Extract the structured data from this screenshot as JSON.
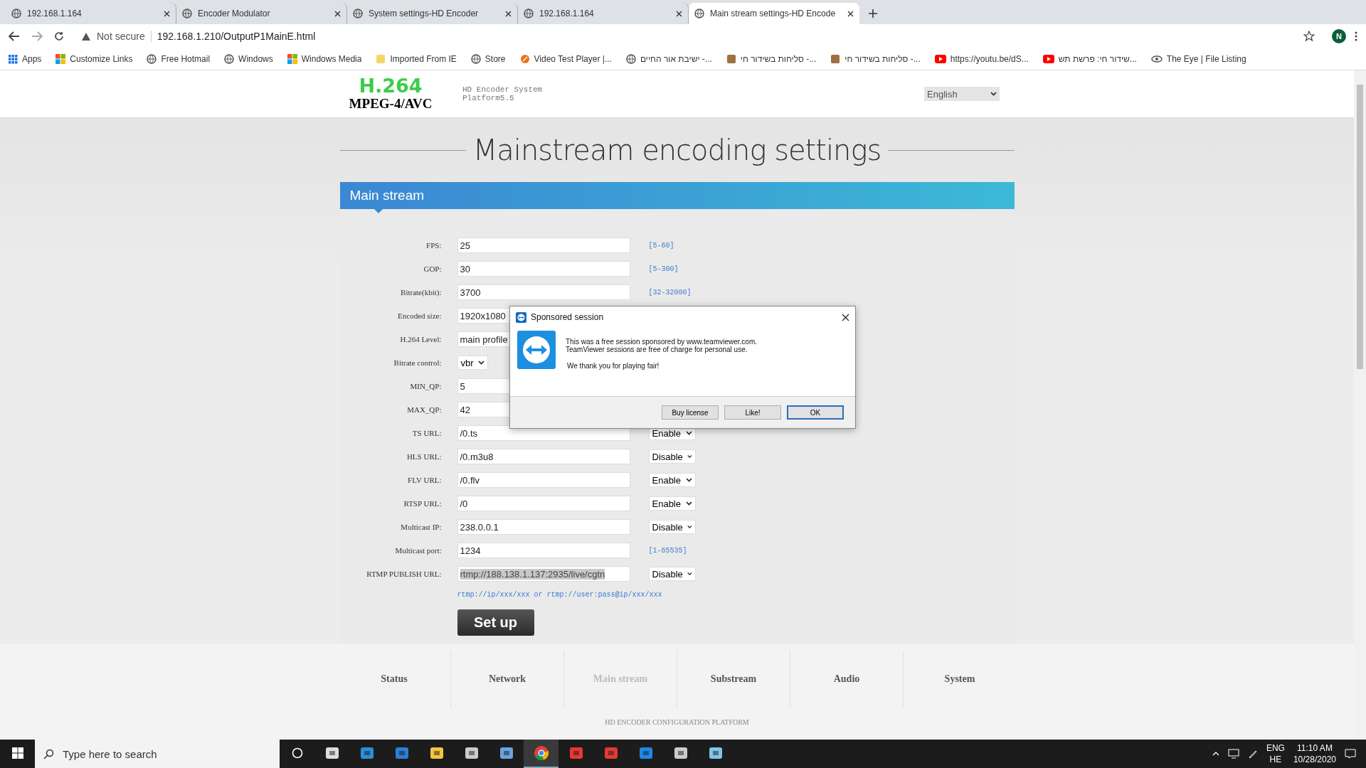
{
  "browser": {
    "tabs": [
      {
        "title": "192.168.1.164",
        "selected": false
      },
      {
        "title": "Encoder Modulator",
        "selected": false
      },
      {
        "title": "System settings-HD Encoder",
        "selected": false
      },
      {
        "title": "192.168.1.164",
        "selected": false
      },
      {
        "title": "Main stream settings-HD Encode",
        "selected": true
      }
    ],
    "security": "Not secure",
    "url": "192.168.1.210/OutputP1MainE.html",
    "profile": "N",
    "bookmarks": [
      "Apps",
      "Customize Links",
      "Free Hotmail",
      "Windows",
      "Windows Media",
      "Imported From IE",
      "Store",
      "Video Test Player |...",
      "ישיבת אור החיים -...",
      "סליחות בשידור חי -...",
      "סליחות בשידור חי -...",
      "https://youtu.be/dS...",
      "שידור חי: פרשת תש...",
      "The Eye | File Listing"
    ]
  },
  "header": {
    "logo_top": "H.264",
    "logo_bottom": "MPEG-4/AVC",
    "subtitle_1": "HD Encoder System",
    "subtitle_2": "Platform5.5",
    "language": "English"
  },
  "page_title": "Mainstream encoding settings",
  "panel_title": "Main stream",
  "form": [
    {
      "label": "FPS:",
      "kind": "input",
      "value": "25",
      "hint": "[5-60]"
    },
    {
      "label": "GOP:",
      "kind": "input",
      "value": "30",
      "hint": "[5-300]"
    },
    {
      "label": "Bitrate(kbit):",
      "kind": "input",
      "value": "3700",
      "hint": "[32-32000]"
    },
    {
      "label": "Encoded size:",
      "kind": "input",
      "value": "1920x1080"
    },
    {
      "label": "H.264 Level:",
      "kind": "input",
      "value": "main profile"
    },
    {
      "label": "Bitrate control:",
      "kind": "select",
      "value": "vbr"
    },
    {
      "label": "MIN_QP:",
      "kind": "input",
      "value": "5"
    },
    {
      "label": "MAX_QP:",
      "kind": "input",
      "value": "42"
    },
    {
      "label": "TS URL:",
      "kind": "input",
      "value": "/0.ts",
      "toggle": "Enable"
    },
    {
      "label": "HLS URL:",
      "kind": "input",
      "value": "/0.m3u8",
      "toggle": "Disable"
    },
    {
      "label": "FLV URL:",
      "kind": "input",
      "value": "/0.flv",
      "toggle": "Enable"
    },
    {
      "label": "RTSP URL:",
      "kind": "input",
      "value": "/0",
      "toggle": "Enable"
    },
    {
      "label": "Multicast IP:",
      "kind": "input",
      "value": "238.0.0.1",
      "toggle": "Disable"
    },
    {
      "label": "Multicast port:",
      "kind": "input",
      "value": "1234",
      "hint": "[1-65535]"
    },
    {
      "label": "RTMP PUBLISH URL:",
      "kind": "input",
      "value": "rtmp://188.138.1.137:2935/live/cgtn",
      "highlighted": true,
      "toggle": "Disable"
    }
  ],
  "form_note": "rtmp://ip/xxx/xxx or rtmp://user:pass@ip/xxx/xxx",
  "submit": "Set up",
  "nav": [
    {
      "label": "Status",
      "selected": false
    },
    {
      "label": "Network",
      "selected": false
    },
    {
      "label": "Main stream",
      "selected": true
    },
    {
      "label": "Substream",
      "selected": false
    },
    {
      "label": "Audio",
      "selected": false
    },
    {
      "label": "System",
      "selected": false
    }
  ],
  "footer": "HD ENCODER CONFIGURATION PLATFORM",
  "dialog": {
    "title": "Sponsored session",
    "lines": [
      "This was a free session sponsored by www.teamviewer.com.",
      "TeamViewer sessions are free of charge for personal use."
    ],
    "thanks": "We thank you for playing fair!",
    "buttons": [
      {
        "label": "Buy license",
        "selected": false
      },
      {
        "label": "Like!",
        "selected": false
      },
      {
        "label": "OK",
        "selected": true
      }
    ]
  },
  "taskbar": {
    "search_placeholder": "Type here to search",
    "lang_1": "ENG",
    "lang_2": "HE",
    "time": "11:10 AM",
    "date": "10/28/2020",
    "apps": [
      {
        "selected": false
      },
      {
        "selected": false
      },
      {
        "selected": false
      },
      {
        "selected": false
      },
      {
        "selected": false
      },
      {
        "selected": false
      },
      {
        "selected": false
      },
      {
        "selected": true
      },
      {
        "selected": false
      },
      {
        "selected": false
      },
      {
        "selected": false
      },
      {
        "selected": false
      },
      {
        "selected": false
      }
    ]
  }
}
